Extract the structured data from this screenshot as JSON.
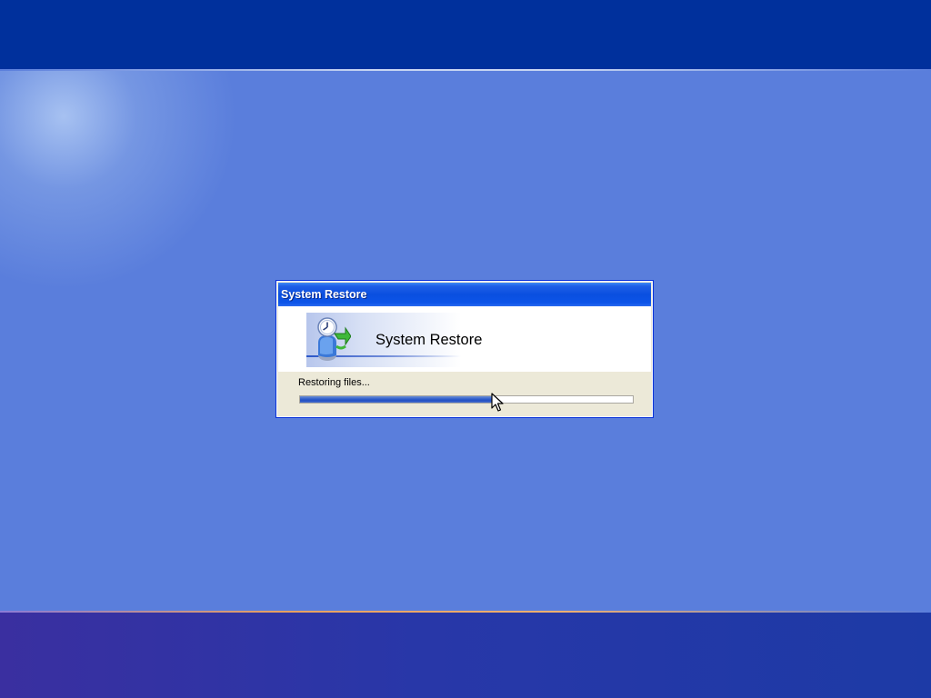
{
  "colors": {
    "desktop": "#5a7edc",
    "top_band": "#00309c",
    "titlebar": "#0a4fe0",
    "dialog_face": "#ece9d8",
    "progress_fill": "#2e5dcb"
  },
  "dialog": {
    "title": "System Restore",
    "header_title": "System Restore",
    "icon": "system-restore-icon",
    "status_text": "Restoring files...",
    "progress": 0.58
  },
  "cursor": {
    "icon": "arrow-cursor-icon"
  }
}
